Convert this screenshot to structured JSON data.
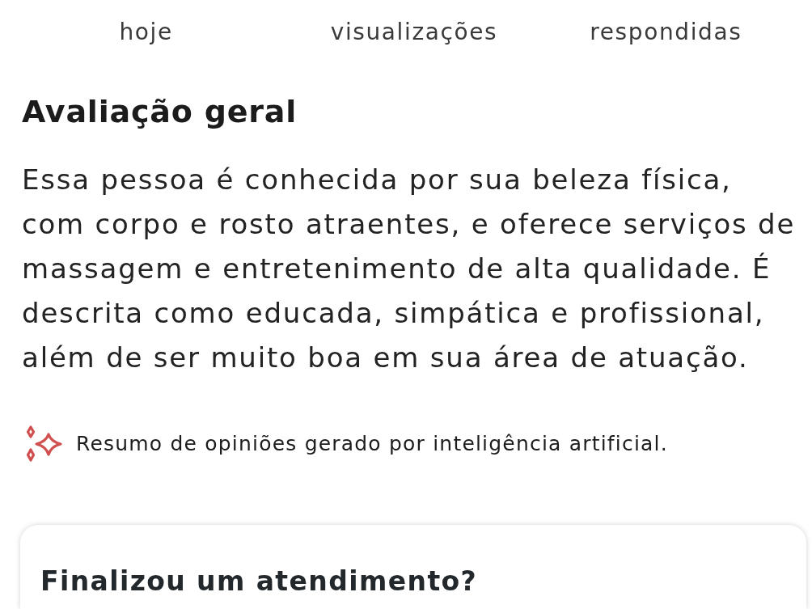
{
  "stats": [
    {
      "label": "hoje"
    },
    {
      "label": "visualizações"
    },
    {
      "label": "respondidas"
    }
  ],
  "summary": {
    "title": "Avaliação geral",
    "text": "Essa pessoa é conhecida por sua beleza física, com corpo e rosto atraentes, e oferece serviços de massagem e entretenimento de alta qualidade. É descrita como educada, simpática e profissional, além de ser muito boa em sua área de atuação.",
    "ai_note": "Resumo de opiniões gerado por inteligência artificial."
  },
  "feedback_card": {
    "title": "Finalizou um atendimento?"
  }
}
